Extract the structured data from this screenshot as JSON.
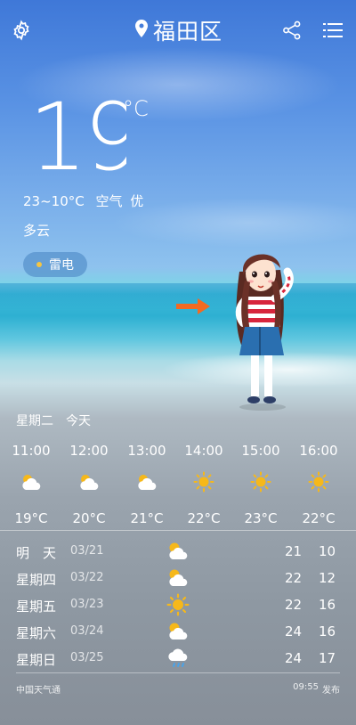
{
  "header": {
    "location": "福田区",
    "icons": [
      "gear-icon",
      "location-pin-icon",
      "share-icon",
      "menu-icon"
    ]
  },
  "current": {
    "temperature": "19",
    "unit": "°C",
    "range": "23~10°C",
    "air_label": "空气",
    "air_quality": "优",
    "condition": "多云",
    "alert": "雷电"
  },
  "hourly": {
    "day_name": "星期二",
    "day_rel": "今天",
    "items": [
      {
        "time": "11:00",
        "icon": "partly-cloudy-icon",
        "temp": "19°C"
      },
      {
        "time": "12:00",
        "icon": "partly-cloudy-icon",
        "temp": "20°C"
      },
      {
        "time": "13:00",
        "icon": "partly-cloudy-icon",
        "temp": "21°C"
      },
      {
        "time": "14:00",
        "icon": "sun-icon",
        "temp": "22°C"
      },
      {
        "time": "15:00",
        "icon": "sun-icon",
        "temp": "23°C"
      },
      {
        "time": "16:00",
        "icon": "sun-icon",
        "temp": "22°C"
      }
    ]
  },
  "daily": [
    {
      "day": "明　天",
      "date": "03/21",
      "icon": "partly-cloudy-icon",
      "high": "21",
      "low": "10"
    },
    {
      "day": "星期四",
      "date": "03/22",
      "icon": "partly-cloudy-icon",
      "high": "22",
      "low": "12"
    },
    {
      "day": "星期五",
      "date": "03/23",
      "icon": "sun-icon",
      "high": "22",
      "low": "16"
    },
    {
      "day": "星期六",
      "date": "03/24",
      "icon": "partly-cloudy-icon",
      "high": "24",
      "low": "16"
    },
    {
      "day": "星期日",
      "date": "03/25",
      "icon": "rain-cloud-icon",
      "high": "24",
      "low": "17"
    }
  ],
  "footer": {
    "source": "中国天气通",
    "time": "09:55",
    "publish": "发布"
  },
  "colors": {
    "sun": "#f6b81a",
    "alert_dot": "#f5c542",
    "arrow": "#f26a22"
  }
}
